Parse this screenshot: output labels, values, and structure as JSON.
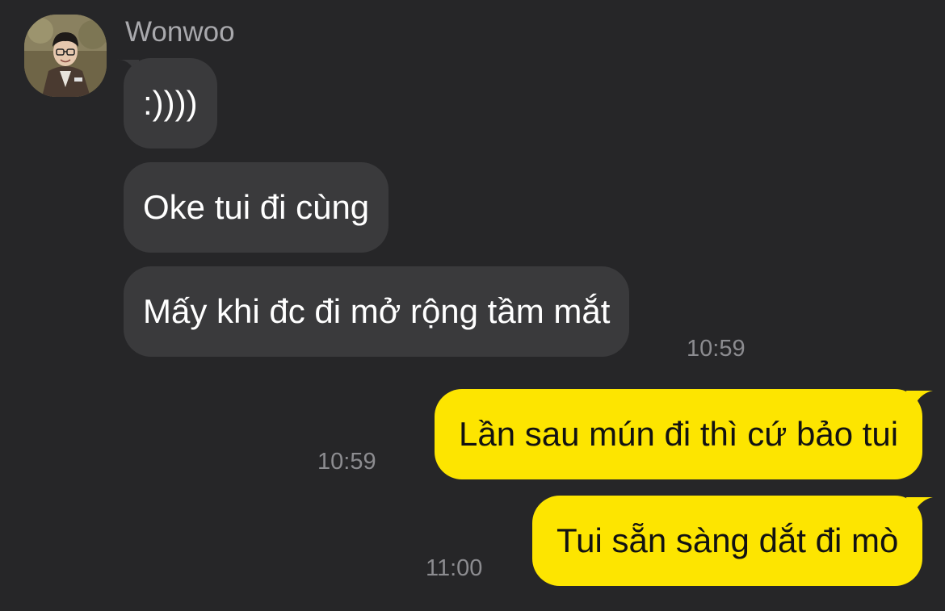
{
  "contact": {
    "name": "Wonwoo",
    "avatar": "profile-photo"
  },
  "messages": [
    {
      "direction": "incoming",
      "text": ":))))",
      "time": ""
    },
    {
      "direction": "incoming",
      "text": "Oke tui đi cùng",
      "time": ""
    },
    {
      "direction": "incoming",
      "text": "Mấy khi đc đi mở rộng tầm mắt",
      "time": "10:59"
    },
    {
      "direction": "outgoing",
      "text": "Lần sau mún đi thì cứ bảo tui",
      "time": "10:59"
    },
    {
      "direction": "outgoing",
      "text": "Tui sẵn sàng dắt đi mò",
      "time": "11:00"
    }
  ],
  "colors": {
    "background": "#262628",
    "incoming_bubble": "#3a3a3c",
    "outgoing_bubble": "#fde500",
    "timestamp": "#8c8c90",
    "sender_name": "#a9a9ad"
  }
}
